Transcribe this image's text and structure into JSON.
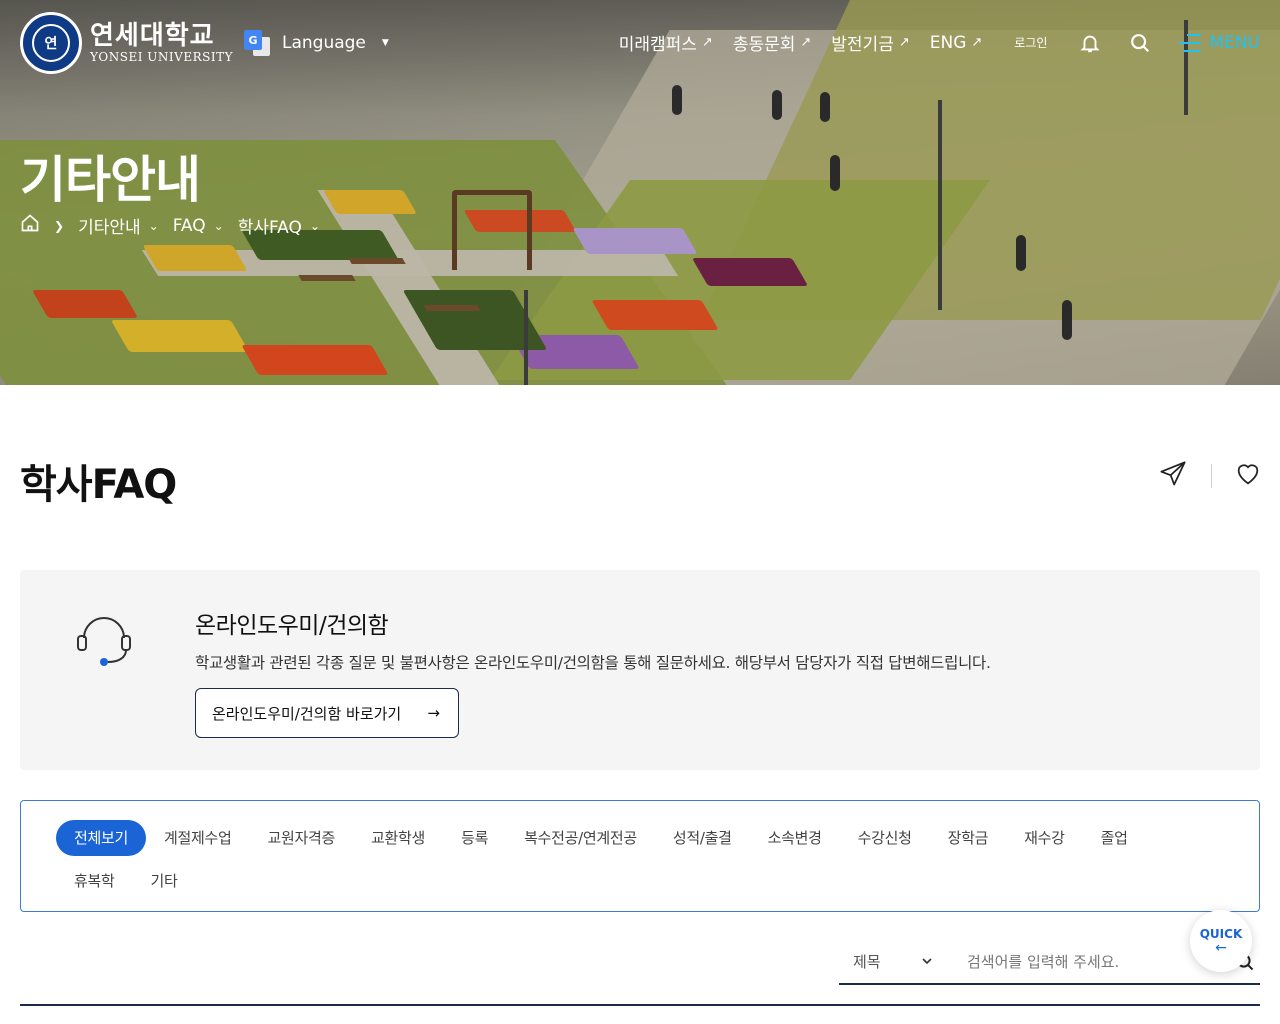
{
  "header": {
    "logo_kr": "연세대학교",
    "logo_en": "YONSEI UNIVERSITY",
    "language_label": "Language",
    "nav": [
      "미래캠퍼스",
      "총동문회",
      "발전기금",
      "ENG"
    ],
    "login_label": "로그인",
    "menu_label": "MENU"
  },
  "hero": {
    "title": "기타안내",
    "breadcrumb": [
      "기타안내",
      "FAQ",
      "학사FAQ"
    ]
  },
  "page": {
    "title": "학사FAQ"
  },
  "help": {
    "title": "온라인도우미/건의함",
    "description": "학교생활과 관련된 각종 질문 및 불편사항은 온라인도우미/건의함을 통해 질문하세요. 해당부서 담당자가 직접 답변해드립니다.",
    "link_label": "온라인도우미/건의함 바로가기"
  },
  "filters": {
    "active": "전체보기",
    "row1": [
      "전체보기",
      "계절제수업",
      "교원자격증",
      "교환학생",
      "등록",
      "복수전공/연계전공",
      "성적/출결",
      "소속변경",
      "수강신청",
      "장학금",
      "재수강",
      "졸업"
    ],
    "row2": [
      "휴복학",
      "기타"
    ]
  },
  "search": {
    "select_value": "제목",
    "placeholder": "검색어를 입력해 주세요."
  },
  "quick": {
    "label": "QUICK"
  },
  "colors": {
    "accent_blue": "#1a64d6",
    "menu_cyan": "#23c2ee",
    "navy": "#1a2b4c",
    "box_gray": "#f5f5f6"
  }
}
